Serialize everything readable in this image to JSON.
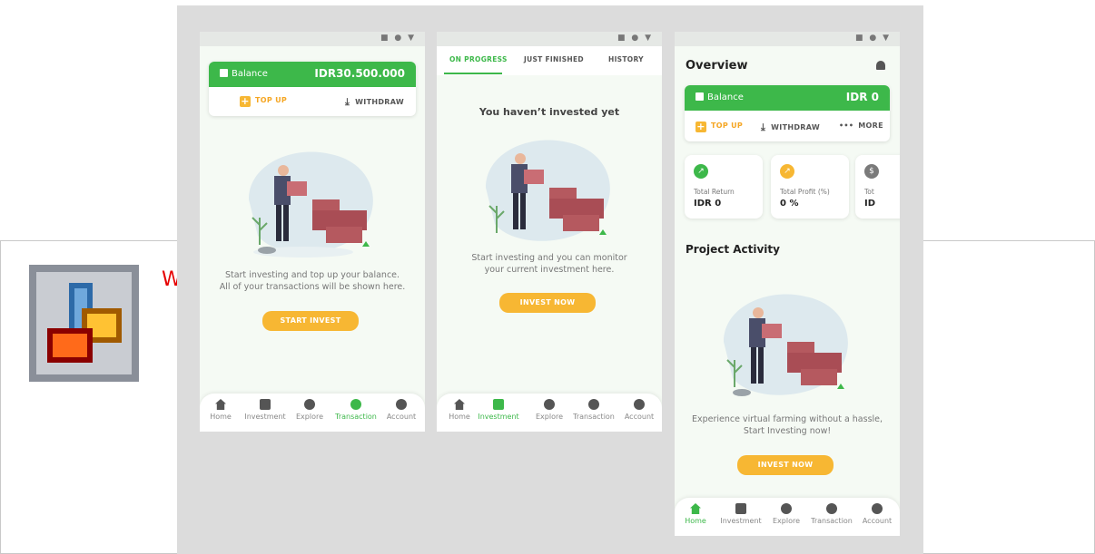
{
  "background_window": {
    "text": "W"
  },
  "screen1": {
    "balance_label": "Balance",
    "balance_amount": "IDR30.500.000",
    "topup_label": "TOP UP",
    "withdraw_label": "WITHDRAW",
    "message_line1": "Start investing and top up your balance.",
    "message_line2": "All of your transactions will be shown here.",
    "button_label": "START INVEST",
    "nav": [
      "Home",
      "Investment",
      "Explore",
      "Transaction",
      "Account"
    ],
    "active_nav": "Transaction"
  },
  "screen2": {
    "tabs": [
      "ON PROGRESS",
      "JUST FINISHED",
      "HISTORY"
    ],
    "active_tab": "ON PROGRESS",
    "heading": "You haven’t invested yet",
    "message_line1": "Start investing and you can monitor",
    "message_line2": "your current investment here.",
    "button_label": "INVEST NOW",
    "nav": [
      "Home",
      "Investment",
      "Explore",
      "Transaction",
      "Account"
    ],
    "active_nav": "Investment"
  },
  "screen3": {
    "title": "Overview",
    "balance_label": "Balance",
    "balance_amount": "IDR 0",
    "topup_label": "TOP UP",
    "withdraw_label": "WITHDRAW",
    "more_label": "MORE",
    "stats": [
      {
        "label": "Total Return",
        "value": "IDR 0"
      },
      {
        "label": "Total Profit (%)",
        "value": "0 %"
      },
      {
        "label": "Tot",
        "value": "ID"
      }
    ],
    "section_title": "Project Activity",
    "message_line1": "Experience virtual farming without a hassle,",
    "message_line2": "Start Investing now!",
    "button_label": "INVEST NOW",
    "nav": [
      "Home",
      "Investment",
      "Explore",
      "Transaction",
      "Account"
    ],
    "active_nav": "Home"
  },
  "colors": {
    "primary_green": "#3db84a",
    "accent_yellow": "#f7b733"
  }
}
